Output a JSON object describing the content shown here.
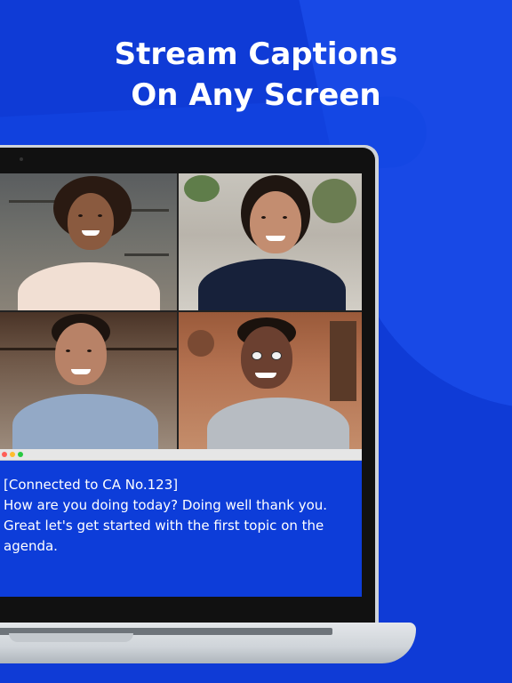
{
  "headline": {
    "line1": "Stream Captions",
    "line2": "On Any Screen"
  },
  "video_call": {
    "participants": [
      {
        "id": "participant-1"
      },
      {
        "id": "participant-2"
      },
      {
        "id": "participant-3"
      },
      {
        "id": "participant-4"
      }
    ]
  },
  "caption_window": {
    "line1": "[Connected to CA No.123]",
    "line2": "How are you doing today? Doing well thank you.",
    "line3": "Great let's get started with the first topic on the",
    "line4": "agenda."
  },
  "colors": {
    "background": "#0f3bd6",
    "caption_background": "#0d3dd9",
    "caption_text": "#ffffff",
    "window_dot_red": "#ff5f57",
    "window_dot_yellow": "#febc2e",
    "window_dot_green": "#28c840"
  }
}
